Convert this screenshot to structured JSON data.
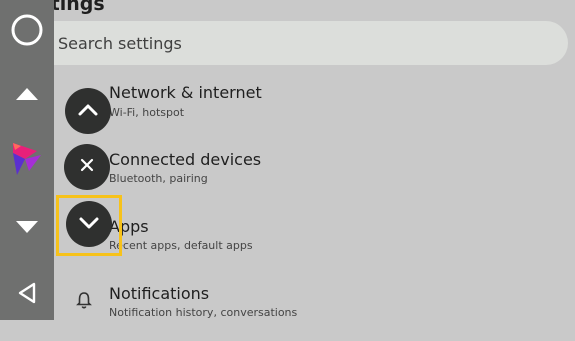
{
  "page": {
    "title": "Settings"
  },
  "search": {
    "placeholder": "Search settings"
  },
  "settings_items": [
    {
      "title": "Network & internet",
      "subtitle": "Wi-Fi, hotspot"
    },
    {
      "title": "Connected devices",
      "subtitle": "Bluetooth, pairing"
    },
    {
      "title": "Apps",
      "subtitle": "Recent apps, default apps"
    },
    {
      "title": "Notifications",
      "subtitle": "Notification history, conversations",
      "icon": "bell-icon"
    }
  ],
  "nav_rail": {
    "icons": [
      "home-circle-icon",
      "arrow-up-icon",
      "app-logo-icon",
      "arrow-down-icon",
      "back-icon"
    ]
  },
  "overlay_buttons": {
    "icons": [
      "chevron-up-icon",
      "close-icon",
      "chevron-down-icon"
    ],
    "highlight_color": "#f7c21a"
  },
  "colors": {
    "background": "#c9c9c9",
    "rail": "#6f706f",
    "fab": "#2f302f",
    "search_bar": "#dcdedb"
  }
}
